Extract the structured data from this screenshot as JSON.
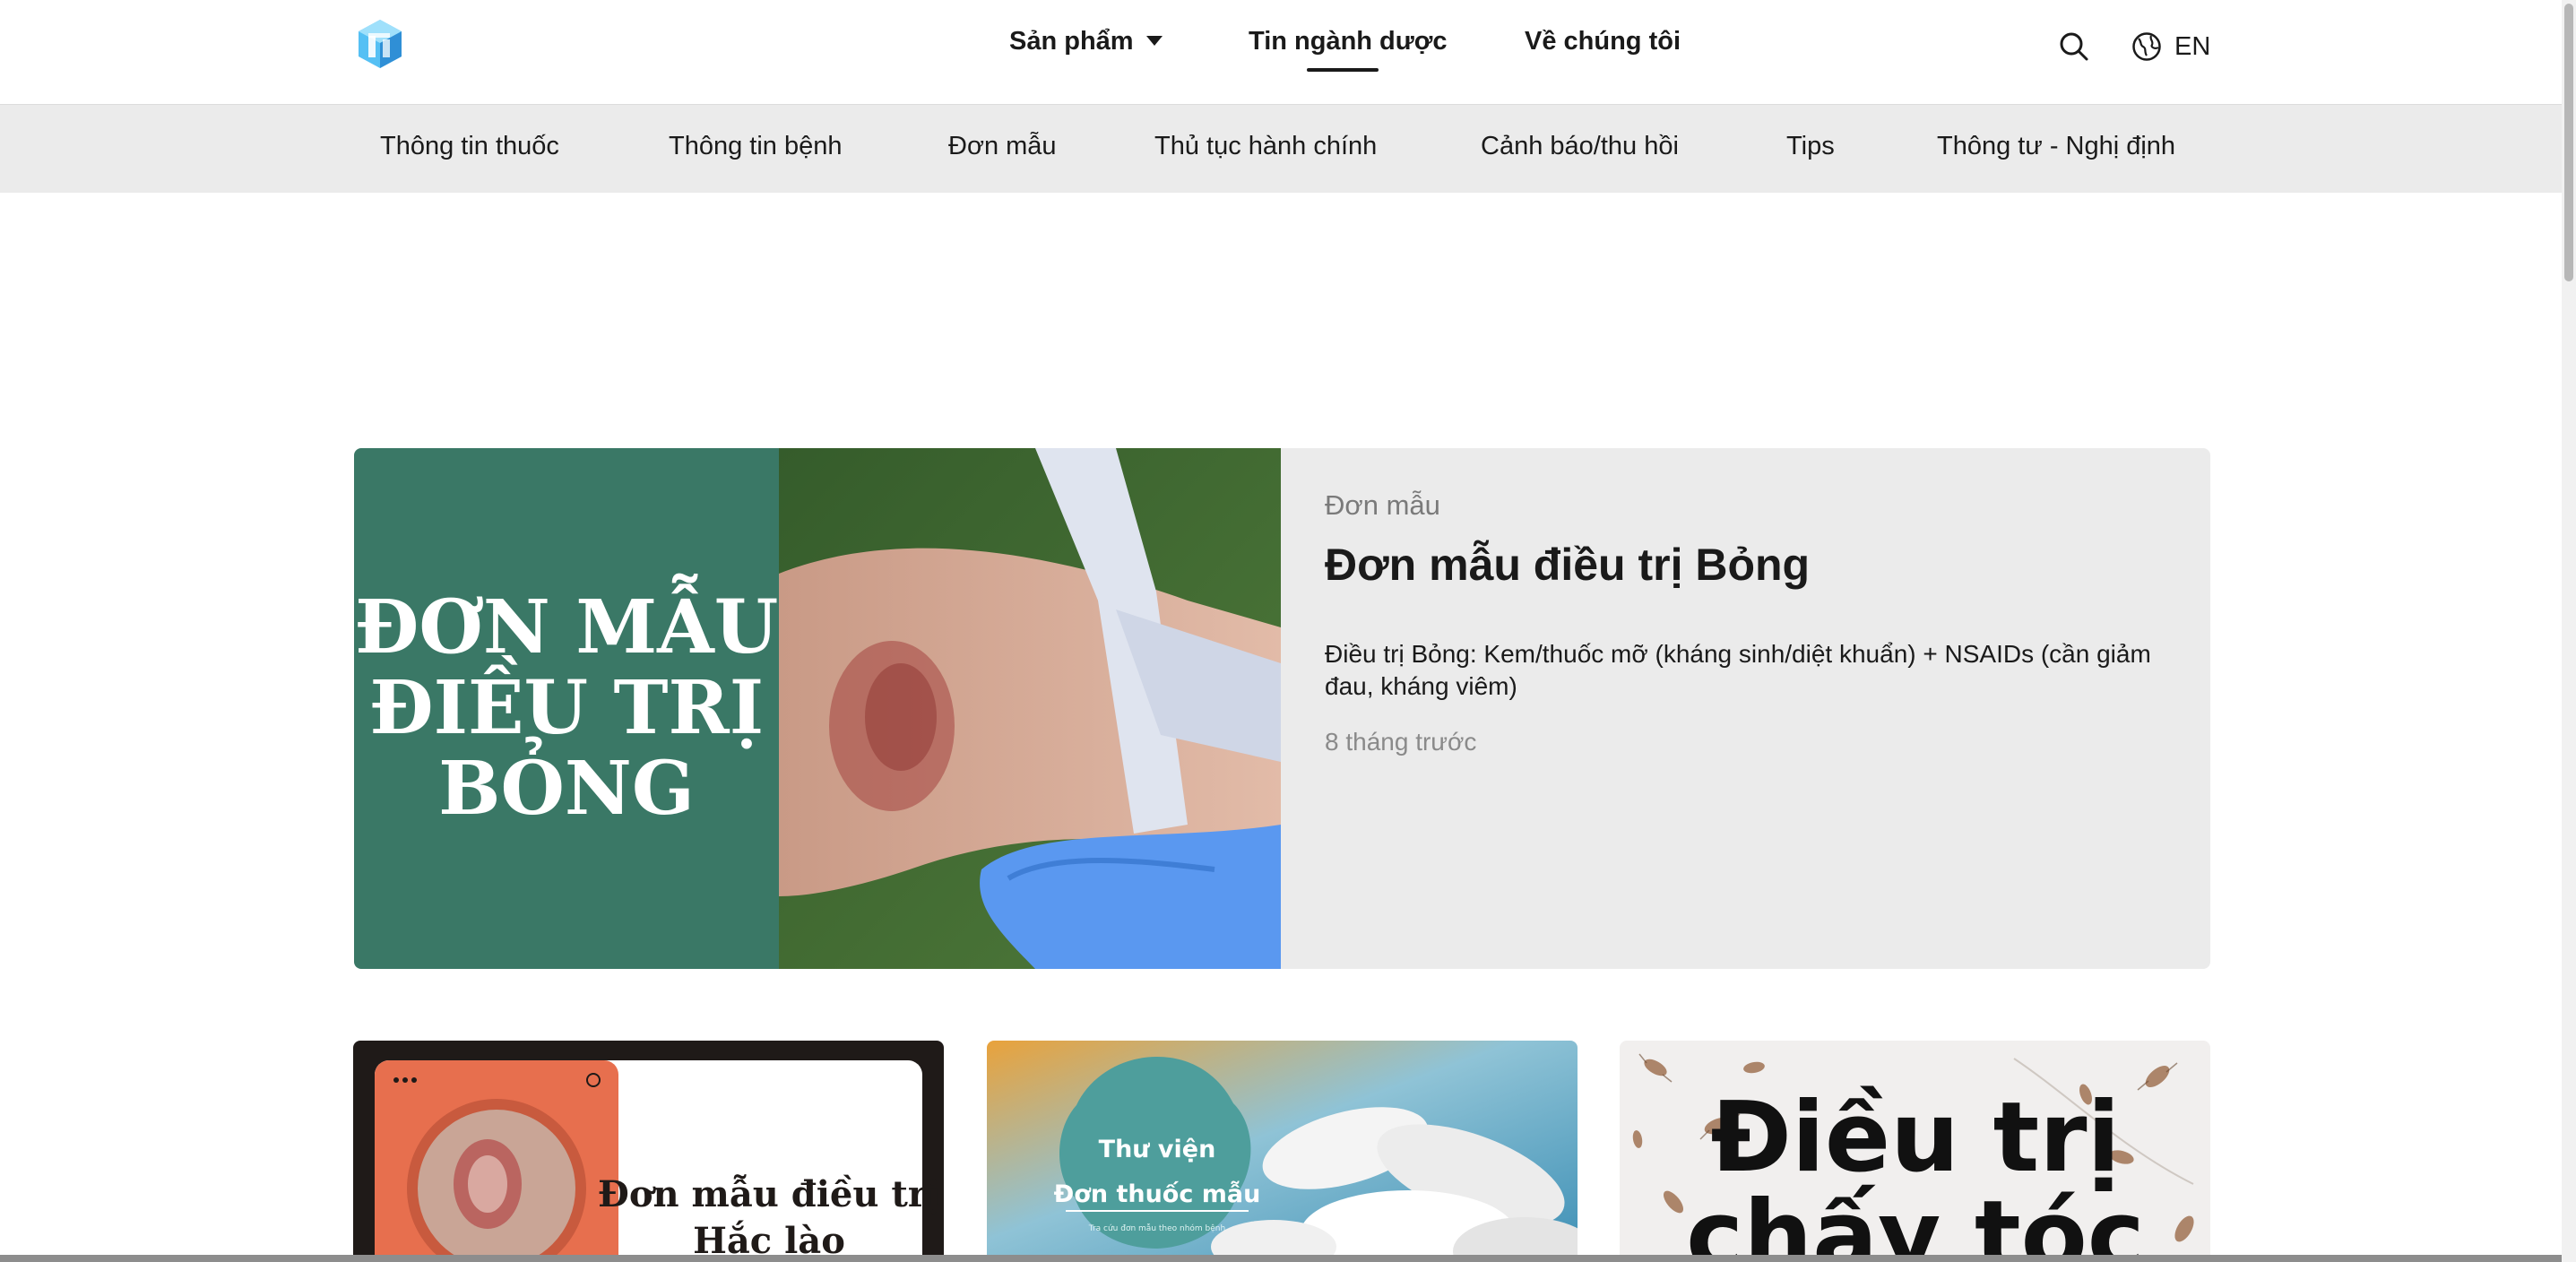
{
  "header": {
    "nav": [
      {
        "label": "Sản phẩm",
        "has_dropdown": true
      },
      {
        "label": "Tin ngành dược",
        "active": true
      },
      {
        "label": "Về chúng tôi"
      }
    ],
    "lang_label": "EN",
    "icons": {
      "logo": "brand-cube-logo",
      "search": "search-icon",
      "lang": "globe-icon"
    }
  },
  "subnav": {
    "items": [
      {
        "label": "Thông tin thuốc"
      },
      {
        "label": "Thông tin bệnh"
      },
      {
        "label": "Đơn mẫu"
      },
      {
        "label": "Thủ tục hành chính"
      },
      {
        "label": "Cảnh báo/thu hồi"
      },
      {
        "label": "Tips"
      },
      {
        "label": "Thông tư - Nghị định"
      }
    ]
  },
  "featured": {
    "image_text": [
      "ĐƠN MẪU",
      "ĐIỀU TRỊ",
      "BỎNG"
    ],
    "category": "Đơn mẫu",
    "title": "Đơn mẫu điều trị Bỏng",
    "description": "Điều trị Bỏng: Kem/thuốc mỡ (kháng sinh/diệt khuẩn) + NSAIDs (cần giảm đau, kháng viêm)",
    "time": "8 tháng trước"
  },
  "cards": [
    {
      "image_text": [
        "Đơn mẫu điều trị",
        "Hắc lào"
      ]
    },
    {
      "image_text": [
        "Thư viện",
        "Đơn thuốc mẫu",
        "Tra cứu đơn mẫu theo nhóm bệnh"
      ]
    },
    {
      "image_text": [
        "Điều trị",
        "chấy tóc"
      ]
    }
  ],
  "colors": {
    "accent": "#1a1a1a",
    "subnav_bg": "#ebebeb",
    "feature_bg": "#ebebeb",
    "feature_green": "#3a7866",
    "logo_blue": "#4ab3ee"
  }
}
